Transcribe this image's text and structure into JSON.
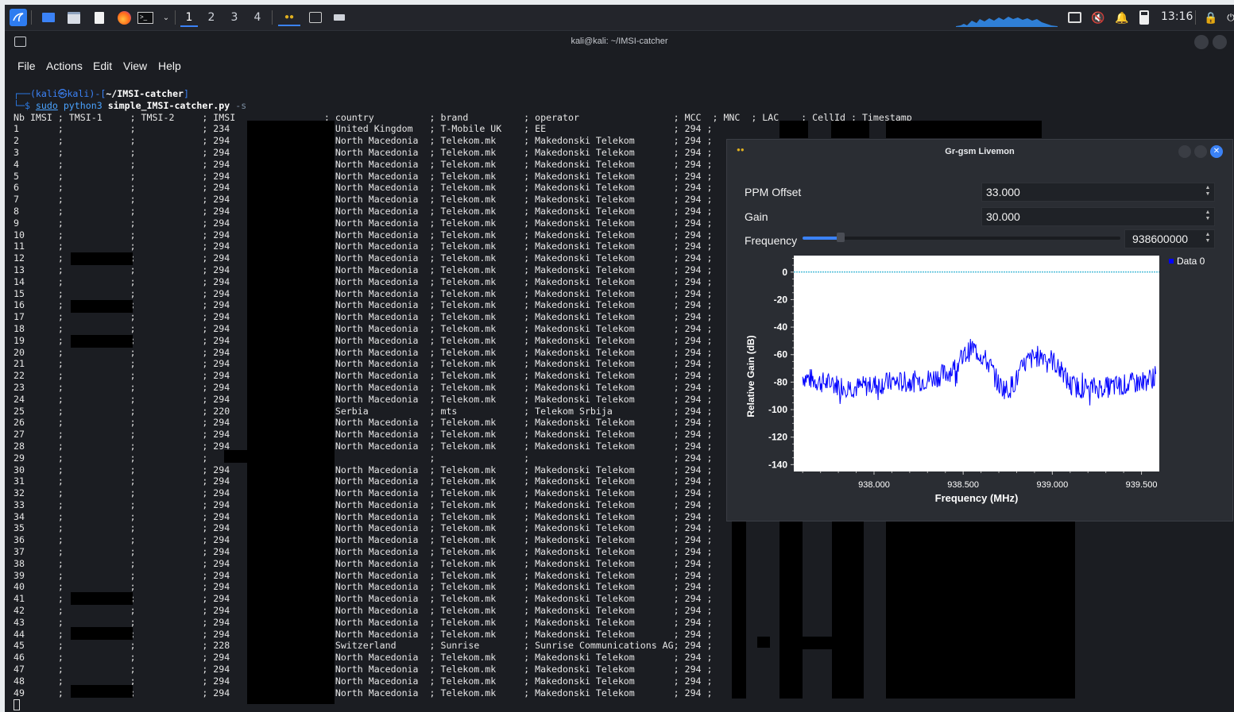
{
  "panel": {
    "workspaces": [
      "1",
      "2",
      "3",
      "4"
    ],
    "active_workspace": 0,
    "clock": "13:16",
    "icons": [
      "kali-menu-icon",
      "show-desktop-icon",
      "file-manager-icon",
      "text-editor-icon",
      "firefox-icon",
      "terminal-icon",
      "chevron-down-icon",
      "livemon-task-icon",
      "terminal-task-icon",
      "keyboard-icon",
      "screen-icon",
      "mute-icon",
      "bell-icon",
      "battery-icon",
      "lock-icon",
      "power-icon"
    ]
  },
  "terminal": {
    "title": "kali@kali: ~/IMSI-catcher",
    "menu": [
      "File",
      "Actions",
      "Edit",
      "View",
      "Help"
    ],
    "prompt_user": "(kali㉿kali)-[",
    "prompt_path": "~/IMSI-catcher",
    "prompt_close": "]",
    "command_sudo": "sudo",
    "command_py": "python3",
    "command_script": "simple_IMSI-catcher.py",
    "command_arg": "-s",
    "header": "Nb IMSI ; TMSI-1     ; TMSI-2     ; IMSI                ; country          ; brand          ; operator                 ; MCC  ; MNC  ; LAC    ; CellId ; Timestamp",
    "rows": [
      {
        "nb": "1",
        "mcc": "234",
        "country": "United Kingdom",
        "brand": "T-Mobile UK",
        "operator": "EE",
        "mcc2": "294"
      },
      {
        "nb": "2",
        "mcc": "294",
        "country": "North Macedonia",
        "brand": "Telekom.mk",
        "operator": "Makedonski Telekom",
        "mcc2": "294"
      },
      {
        "nb": "3",
        "mcc": "294",
        "country": "North Macedonia",
        "brand": "Telekom.mk",
        "operator": "Makedonski Telekom",
        "mcc2": "294"
      },
      {
        "nb": "4",
        "mcc": "294",
        "country": "North Macedonia",
        "brand": "Telekom.mk",
        "operator": "Makedonski Telekom",
        "mcc2": "294"
      },
      {
        "nb": "5",
        "mcc": "294",
        "country": "North Macedonia",
        "brand": "Telekom.mk",
        "operator": "Makedonski Telekom",
        "mcc2": "294"
      },
      {
        "nb": "6",
        "mcc": "294",
        "country": "North Macedonia",
        "brand": "Telekom.mk",
        "operator": "Makedonski Telekom",
        "mcc2": "294"
      },
      {
        "nb": "7",
        "mcc": "294",
        "country": "North Macedonia",
        "brand": "Telekom.mk",
        "operator": "Makedonski Telekom",
        "mcc2": "294"
      },
      {
        "nb": "8",
        "mcc": "294",
        "country": "North Macedonia",
        "brand": "Telekom.mk",
        "operator": "Makedonski Telekom",
        "mcc2": "294"
      },
      {
        "nb": "9",
        "mcc": "294",
        "country": "North Macedonia",
        "brand": "Telekom.mk",
        "operator": "Makedonski Telekom",
        "mcc2": "294"
      },
      {
        "nb": "10",
        "mcc": "294",
        "country": "North Macedonia",
        "brand": "Telekom.mk",
        "operator": "Makedonski Telekom",
        "mcc2": "294"
      },
      {
        "nb": "11",
        "mcc": "294",
        "country": "North Macedonia",
        "brand": "Telekom.mk",
        "operator": "Makedonski Telekom",
        "mcc2": "294"
      },
      {
        "nb": "12",
        "mcc": "294",
        "country": "North Macedonia",
        "brand": "Telekom.mk",
        "operator": "Makedonski Telekom",
        "mcc2": "294"
      },
      {
        "nb": "13",
        "mcc": "294",
        "country": "North Macedonia",
        "brand": "Telekom.mk",
        "operator": "Makedonski Telekom",
        "mcc2": "294"
      },
      {
        "nb": "14",
        "mcc": "294",
        "country": "North Macedonia",
        "brand": "Telekom.mk",
        "operator": "Makedonski Telekom",
        "mcc2": "294"
      },
      {
        "nb": "15",
        "mcc": "294",
        "country": "North Macedonia",
        "brand": "Telekom.mk",
        "operator": "Makedonski Telekom",
        "mcc2": "294"
      },
      {
        "nb": "16",
        "mcc": "294",
        "country": "North Macedonia",
        "brand": "Telekom.mk",
        "operator": "Makedonski Telekom",
        "mcc2": "294"
      },
      {
        "nb": "17",
        "mcc": "294",
        "country": "North Macedonia",
        "brand": "Telekom.mk",
        "operator": "Makedonski Telekom",
        "mcc2": "294"
      },
      {
        "nb": "18",
        "mcc": "294",
        "country": "North Macedonia",
        "brand": "Telekom.mk",
        "operator": "Makedonski Telekom",
        "mcc2": "294"
      },
      {
        "nb": "19",
        "mcc": "294",
        "country": "North Macedonia",
        "brand": "Telekom.mk",
        "operator": "Makedonski Telekom",
        "mcc2": "294"
      },
      {
        "nb": "20",
        "mcc": "294",
        "country": "North Macedonia",
        "brand": "Telekom.mk",
        "operator": "Makedonski Telekom",
        "mcc2": "294"
      },
      {
        "nb": "21",
        "mcc": "294",
        "country": "North Macedonia",
        "brand": "Telekom.mk",
        "operator": "Makedonski Telekom",
        "mcc2": "294"
      },
      {
        "nb": "22",
        "mcc": "294",
        "country": "North Macedonia",
        "brand": "Telekom.mk",
        "operator": "Makedonski Telekom",
        "mcc2": "294"
      },
      {
        "nb": "23",
        "mcc": "294",
        "country": "North Macedonia",
        "brand": "Telekom.mk",
        "operator": "Makedonski Telekom",
        "mcc2": "294"
      },
      {
        "nb": "24",
        "mcc": "294",
        "country": "North Macedonia",
        "brand": "Telekom.mk",
        "operator": "Makedonski Telekom",
        "mcc2": "294"
      },
      {
        "nb": "25",
        "mcc": "220",
        "country": "Serbia",
        "brand": "mts",
        "operator": "Telekom Srbija",
        "mcc2": "294"
      },
      {
        "nb": "26",
        "mcc": "294",
        "country": "North Macedonia",
        "brand": "Telekom.mk",
        "operator": "Makedonski Telekom",
        "mcc2": "294"
      },
      {
        "nb": "27",
        "mcc": "294",
        "country": "North Macedonia",
        "brand": "Telekom.mk",
        "operator": "Makedonski Telekom",
        "mcc2": "294"
      },
      {
        "nb": "28",
        "mcc": "294",
        "country": "North Macedonia",
        "brand": "Telekom.mk",
        "operator": "Makedonski Telekom",
        "mcc2": "294"
      },
      {
        "nb": "29",
        "mcc": "",
        "country": "",
        "brand": "",
        "operator": "",
        "mcc2": "294"
      },
      {
        "nb": "30",
        "mcc": "294",
        "country": "North Macedonia",
        "brand": "Telekom.mk",
        "operator": "Makedonski Telekom",
        "mcc2": "294"
      },
      {
        "nb": "31",
        "mcc": "294",
        "country": "North Macedonia",
        "brand": "Telekom.mk",
        "operator": "Makedonski Telekom",
        "mcc2": "294"
      },
      {
        "nb": "32",
        "mcc": "294",
        "country": "North Macedonia",
        "brand": "Telekom.mk",
        "operator": "Makedonski Telekom",
        "mcc2": "294"
      },
      {
        "nb": "33",
        "mcc": "294",
        "country": "North Macedonia",
        "brand": "Telekom.mk",
        "operator": "Makedonski Telekom",
        "mcc2": "294"
      },
      {
        "nb": "34",
        "mcc": "294",
        "country": "North Macedonia",
        "brand": "Telekom.mk",
        "operator": "Makedonski Telekom",
        "mcc2": "294"
      },
      {
        "nb": "35",
        "mcc": "294",
        "country": "North Macedonia",
        "brand": "Telekom.mk",
        "operator": "Makedonski Telekom",
        "mcc2": "294"
      },
      {
        "nb": "36",
        "mcc": "294",
        "country": "North Macedonia",
        "brand": "Telekom.mk",
        "operator": "Makedonski Telekom",
        "mcc2": "294"
      },
      {
        "nb": "37",
        "mcc": "294",
        "country": "North Macedonia",
        "brand": "Telekom.mk",
        "operator": "Makedonski Telekom",
        "mcc2": "294"
      },
      {
        "nb": "38",
        "mcc": "294",
        "country": "North Macedonia",
        "brand": "Telekom.mk",
        "operator": "Makedonski Telekom",
        "mcc2": "294"
      },
      {
        "nb": "39",
        "mcc": "294",
        "country": "North Macedonia",
        "brand": "Telekom.mk",
        "operator": "Makedonski Telekom",
        "mcc2": "294"
      },
      {
        "nb": "40",
        "mcc": "294",
        "country": "North Macedonia",
        "brand": "Telekom.mk",
        "operator": "Makedonski Telekom",
        "mcc2": "294"
      },
      {
        "nb": "41",
        "mcc": "294",
        "country": "North Macedonia",
        "brand": "Telekom.mk",
        "operator": "Makedonski Telekom",
        "mcc2": "294"
      },
      {
        "nb": "42",
        "mcc": "294",
        "country": "North Macedonia",
        "brand": "Telekom.mk",
        "operator": "Makedonski Telekom",
        "mcc2": "294"
      },
      {
        "nb": "43",
        "mcc": "294",
        "country": "North Macedonia",
        "brand": "Telekom.mk",
        "operator": "Makedonski Telekom",
        "mcc2": "294"
      },
      {
        "nb": "44",
        "mcc": "294",
        "country": "North Macedonia",
        "brand": "Telekom.mk",
        "operator": "Makedonski Telekom",
        "mcc2": "294"
      },
      {
        "nb": "45",
        "mcc": "228",
        "country": "Switzerland",
        "brand": "Sunrise",
        "operator": "Sunrise Communications AG",
        "mcc2": "294"
      },
      {
        "nb": "46",
        "mcc": "294",
        "country": "North Macedonia",
        "brand": "Telekom.mk",
        "operator": "Makedonski Telekom",
        "mcc2": "294"
      },
      {
        "nb": "47",
        "mcc": "294",
        "country": "North Macedonia",
        "brand": "Telekom.mk",
        "operator": "Makedonski Telekom",
        "mcc2": "294"
      },
      {
        "nb": "48",
        "mcc": "294",
        "country": "North Macedonia",
        "brand": "Telekom.mk",
        "operator": "Makedonski Telekom",
        "mcc2": "294"
      },
      {
        "nb": "49",
        "mcc": "294",
        "country": "North Macedonia",
        "brand": "Telekom.mk",
        "operator": "Makedonski Telekom",
        "mcc2": "294"
      }
    ]
  },
  "livemon": {
    "title": "Gr-gsm Livemon",
    "ppm_label": "PPM Offset",
    "ppm_value": "33.000",
    "gain_label": "Gain",
    "gain_value": "30.000",
    "freq_label": "Frequency",
    "freq_value": "938600000",
    "freq_slider_fraction": 0.12
  },
  "chart_data": {
    "type": "line",
    "title": "",
    "xlabel": "Frequency (MHz)",
    "ylabel": "Relative Gain (dB)",
    "xlim": [
      937.55,
      939.6
    ],
    "ylim": [
      -145,
      12
    ],
    "xticks": [
      "938.000",
      "938.500",
      "939.000",
      "939.500"
    ],
    "xtick_values": [
      938.0,
      938.5,
      939.0,
      939.5
    ],
    "yticks": [
      "0",
      "-20",
      "-40",
      "-60",
      "-80",
      "-100",
      "-120",
      "-140"
    ],
    "ytick_values": [
      0,
      -20,
      -40,
      -60,
      -80,
      -100,
      -120,
      -140
    ],
    "legend": "top-right",
    "series": [
      {
        "name": "Data 0",
        "color": "#0000ff",
        "x": [
          937.6,
          937.7,
          937.8,
          937.9,
          938.0,
          938.1,
          938.2,
          938.3,
          938.4,
          938.45,
          938.5,
          938.55,
          938.6,
          938.65,
          938.7,
          938.75,
          938.8,
          938.85,
          938.9,
          938.95,
          939.0,
          939.05,
          939.1,
          939.15,
          939.2,
          939.3,
          939.4,
          939.5,
          939.58
        ],
        "y": [
          -76,
          -80,
          -82,
          -84,
          -82,
          -80,
          -80,
          -78,
          -74,
          -70,
          -62,
          -55,
          -60,
          -68,
          -82,
          -86,
          -78,
          -66,
          -62,
          -60,
          -64,
          -72,
          -82,
          -84,
          -84,
          -84,
          -82,
          -80,
          -76
        ]
      },
      {
        "name": "",
        "color": "#00a0c8",
        "x": [
          937.55,
          939.6
        ],
        "y": [
          0,
          0
        ]
      }
    ]
  }
}
